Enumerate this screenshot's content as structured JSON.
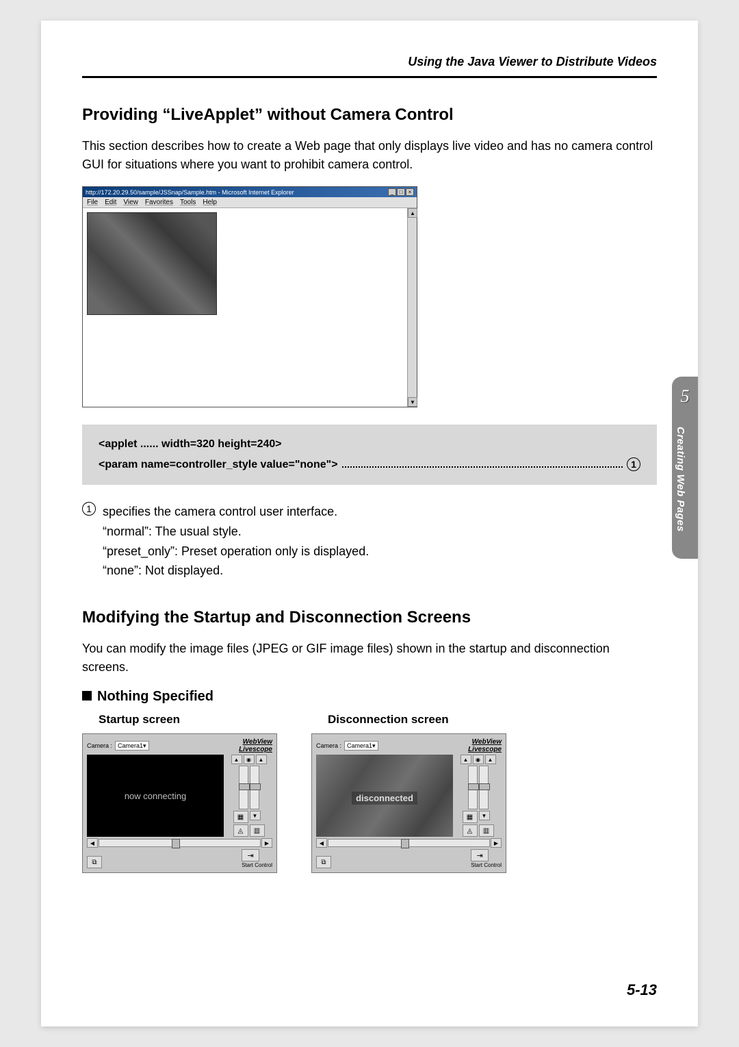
{
  "header": {
    "running": "Using the Java Viewer to Distribute Videos"
  },
  "section1": {
    "title": "Providing “LiveApplet” without Camera Control",
    "body": "This section describes how to create a Web page that only displays live video and has no camera control GUI for situations where you want to prohibit camera control."
  },
  "ie": {
    "title": "http://172.20.29.50/sample/JSSnap/Sample.htm - Microsoft Internet Explorer",
    "menus": [
      "File",
      "Edit",
      "View",
      "Favorites",
      "Tools",
      "Help"
    ],
    "winbtns": [
      "_",
      "□",
      "×"
    ]
  },
  "code": {
    "line1": "<applet ...... width=320 height=240>",
    "line2": "<param name=controller_style value=\"none\">",
    "marker": "1"
  },
  "spec": {
    "marker": "1",
    "head": "specifies the camera control user interface.",
    "items": [
      "“normal”: The usual style.",
      "“preset_only”: Preset operation only is displayed.",
      "“none”: Not displayed."
    ]
  },
  "section2": {
    "title": "Modifying the Startup and Disconnection Screens",
    "body": "You can modify the image files (JPEG or GIF image files) shown in the startup and disconnection screens."
  },
  "sub": {
    "title": "Nothing Specified"
  },
  "cols": {
    "left": "Startup screen",
    "right": "Disconnection screen"
  },
  "applet": {
    "logo1": "WebView",
    "logo2": "Livescope",
    "camera_label": "Camera :",
    "camera_value": "Camera1",
    "connecting": "now connecting",
    "disconnected": "disconnected",
    "start": "Start Control"
  },
  "tab": {
    "num": "5",
    "text": "Creating Web Pages"
  },
  "pagenum": "5-13"
}
